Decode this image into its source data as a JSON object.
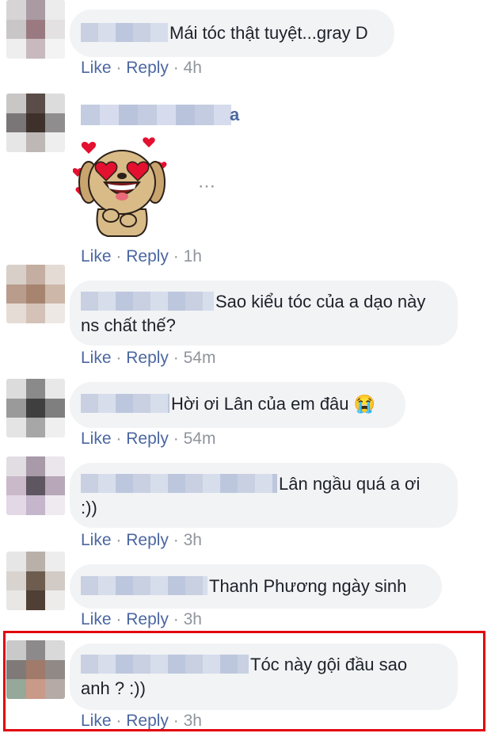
{
  "comments": [
    {
      "text": "Mái tóc thật tuyệt...gray D",
      "like": "Like",
      "reply": "Reply",
      "time": "4h"
    },
    {
      "name_tail": "a",
      "sticker": "heart-eyes-dog-sticker",
      "like": "Like",
      "reply": "Reply",
      "time": "1h"
    },
    {
      "text": "Sao kiểu tóc của a dạo này",
      "text2": "ns chất thế?",
      "like": "Like",
      "reply": "Reply",
      "time": "54m"
    },
    {
      "text": "Hời ơi Lân của em đâu 😭",
      "like": "Like",
      "reply": "Reply",
      "time": "54m"
    },
    {
      "text": "Lân ngầu quá a ơi",
      "text2": ":))",
      "like": "Like",
      "reply": "Reply",
      "time": "3h"
    },
    {
      "text": "Thanh Phương ngày sinh",
      "like": "Like",
      "reply": "Reply",
      "time": "3h"
    },
    {
      "text": "Tóc này gội đầu sao",
      "text2": "anh ? :))",
      "like": "Like",
      "reply": "Reply",
      "time": "3h"
    }
  ],
  "separator": "·",
  "more_icon": "⋯",
  "colors": {
    "link": "#4b67a1",
    "meta": "#90949c",
    "bubble": "#f2f3f5",
    "highlight": "#e3000f"
  }
}
